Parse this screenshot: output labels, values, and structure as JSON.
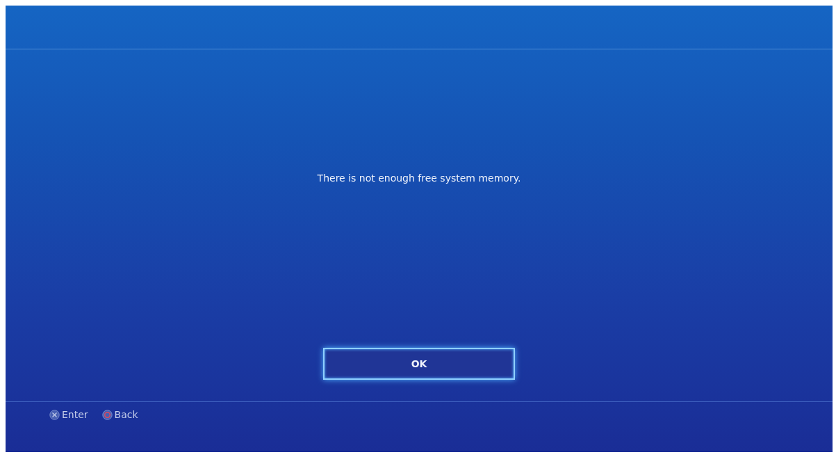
{
  "message": "There is not enough free system memory.",
  "button": {
    "label": "OK",
    "focused": true
  },
  "hints": [
    {
      "kind": "cross",
      "label": "Enter"
    },
    {
      "kind": "circle",
      "label": "Back"
    }
  ]
}
